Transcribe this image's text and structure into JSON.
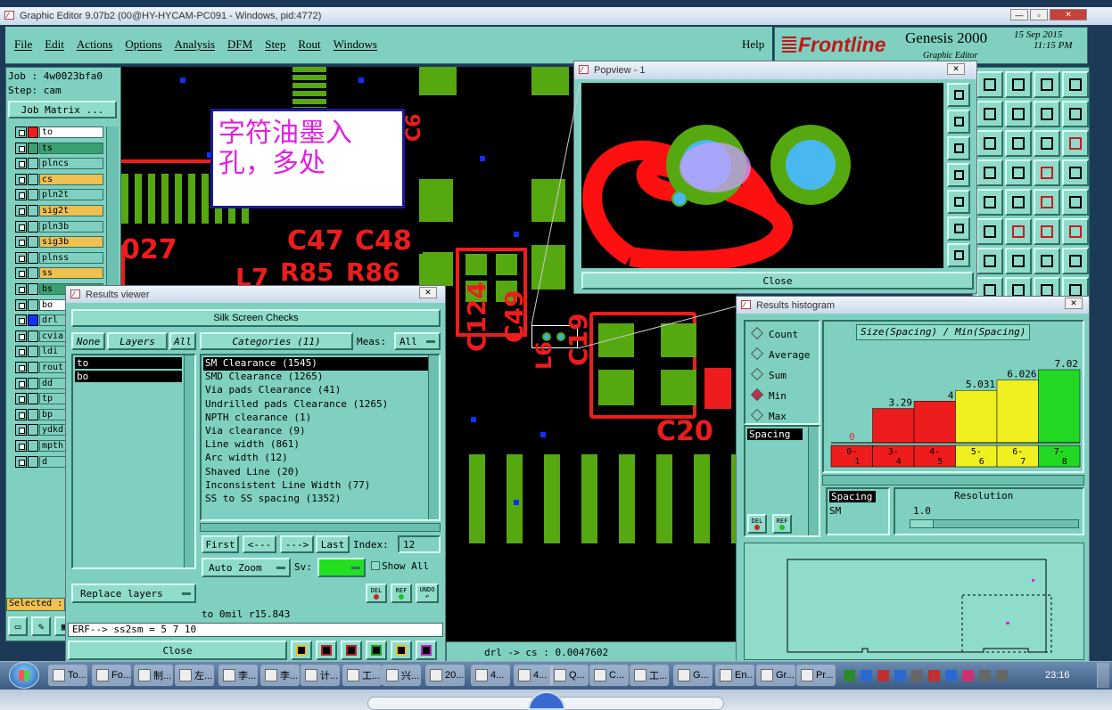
{
  "window": {
    "title": "Graphic Editor 9.07b2 (00@HY-HYCAM-PC091 - Windows, pid:4772)"
  },
  "menu": [
    "File",
    "Edit",
    "Actions",
    "Options",
    "Analysis",
    "DFM",
    "Step",
    "Rout",
    "Windows"
  ],
  "help": "Help",
  "brand": {
    "logo": "Frontline",
    "product": "Genesis 2000",
    "subtitle": "Graphic Editor",
    "date": "15 Sep 2015",
    "time": "11:15 PM"
  },
  "job": {
    "job": "Job : 4w0023bfa0",
    "step": "Step: cam",
    "matrix_btn": "Job Matrix ..."
  },
  "layers": [
    {
      "name": "to",
      "bg": "#ffffff",
      "sw": "#ee1c1c"
    },
    {
      "name": "ts",
      "bg": "#3aa070",
      "sw": "#3aa070"
    },
    {
      "name": "plncs",
      "bg": "#7fd0c0",
      "sw": ""
    },
    {
      "name": "cs",
      "bg": "#f0c050",
      "sw": ""
    },
    {
      "name": "pln2t",
      "bg": "#7fd0c0",
      "sw": ""
    },
    {
      "name": "sig2t",
      "bg": "#f0c050",
      "sw": ""
    },
    {
      "name": "pln3b",
      "bg": "#7fd0c0",
      "sw": ""
    },
    {
      "name": "sig3b",
      "bg": "#f0c050",
      "sw": ""
    },
    {
      "name": "plnss",
      "bg": "#7fd0c0",
      "sw": ""
    },
    {
      "name": "ss",
      "bg": "#f0c050",
      "sw": ""
    },
    {
      "name": "bs",
      "bg": "#3aa070",
      "sw": ""
    },
    {
      "name": "bo",
      "bg": "#ffffff",
      "sw": ""
    },
    {
      "name": "drl",
      "bg": "#7fd0c0",
      "sw": "#1030ff"
    },
    {
      "name": "cvia",
      "bg": "#7fd0c0",
      "sw": ""
    },
    {
      "name": "ldi",
      "bg": "#7fd0c0",
      "sw": ""
    },
    {
      "name": "rout",
      "bg": "#7fd0c0",
      "sw": ""
    },
    {
      "name": "dd",
      "bg": "#7fd0c0",
      "sw": ""
    },
    {
      "name": "tp",
      "bg": "#7fd0c0",
      "sw": ""
    },
    {
      "name": "bp",
      "bg": "#7fd0c0",
      "sw": ""
    },
    {
      "name": "ydkdr",
      "bg": "#7fd0c0",
      "sw": ""
    },
    {
      "name": "mpth",
      "bg": "#7fd0c0",
      "sw": ""
    },
    {
      "name": "d",
      "bg": "#7fd0c0",
      "sw": ""
    }
  ],
  "selected_label": "Selected :",
  "annotation": {
    "line1": "字符油墨入",
    "line2": "孔，多处"
  },
  "pcb_labels": [
    "027",
    "C47",
    "C48",
    "L7",
    "R85",
    "R86",
    "C124",
    "C49",
    "L6",
    "C19",
    "C20",
    "C6"
  ],
  "popview": {
    "title": "Popview - 1",
    "close": "Close"
  },
  "results_viewer": {
    "title": "Results viewer",
    "heading": "Silk Screen Checks",
    "none": "None",
    "layers": "Layers",
    "all": "All",
    "layer_items": [
      "to",
      "bo"
    ],
    "categories_btn": "Categories (11)",
    "meas_label": "Meas:",
    "meas_value": "All",
    "categories": [
      "SM Clearance (1545)",
      "SMD Clearance (1265)",
      "Via pads Clearance (41)",
      "Undrilled pads Clearance (1265)",
      "NPTH clearance (1)",
      "Via clearance (9)",
      "Line width (861)",
      "Arc width (12)",
      "Shaved Line (20)",
      "Inconsistent Line Width (77)",
      "SS to SS spacing (1352)"
    ],
    "first": "First",
    "prev": "<---",
    "next": "--->",
    "last": "Last",
    "index_label": "Index:",
    "index_value": "12",
    "auto_zoom": "Auto Zoom",
    "sv_label": "Sv:",
    "show_all": "Show All",
    "replace_layers": "Replace layers",
    "del": "DEL",
    "ref": "REF",
    "undo": "UNDO",
    "status": "to 0mil  r15.843",
    "erf": "ERF--> ss2sm = 5 7 10",
    "close": "Close"
  },
  "status_bar": "drl -> cs : 0.0047602",
  "histogram": {
    "title": "Results histogram",
    "options": [
      "Count",
      "Average",
      "Sum",
      "Min",
      "Max"
    ],
    "selected": "Min",
    "spacing": "Spacing",
    "heading": "Size(Spacing) / Min(Spacing)",
    "spacing2": "Spacing",
    "sm": "SM",
    "resolution_label": "Resolution",
    "resolution_value": "1.0",
    "del": "DEL",
    "ref": "REF"
  },
  "chart_data": {
    "type": "bar",
    "title": "Size(Spacing) / Min(Spacing)",
    "categories": [
      "0-1",
      "3-4",
      "4-5",
      "5-6",
      "6-7",
      "7-8"
    ],
    "values": [
      0,
      3.29,
      4,
      5.031,
      6.026,
      7.02
    ],
    "value_labels": [
      "0",
      "3.29",
      "4",
      "5.031",
      "6.026",
      "7.02"
    ],
    "colors": [
      "#ee1c1c",
      "#ee1c1c",
      "#ee1c1c",
      "#f0f020",
      "#f0f020",
      "#22d822"
    ],
    "ylim": [
      0,
      7.02
    ]
  },
  "taskbar": {
    "items": [
      "To...",
      "Fo...",
      "制...",
      "左...",
      "李...",
      "李...",
      "计...",
      "工...",
      "兴...",
      "20...",
      "4...",
      "4...",
      "Q...",
      "C...",
      "工...",
      "G...",
      "En...",
      "Gr...",
      "Pr..."
    ],
    "clock": "23:16"
  }
}
